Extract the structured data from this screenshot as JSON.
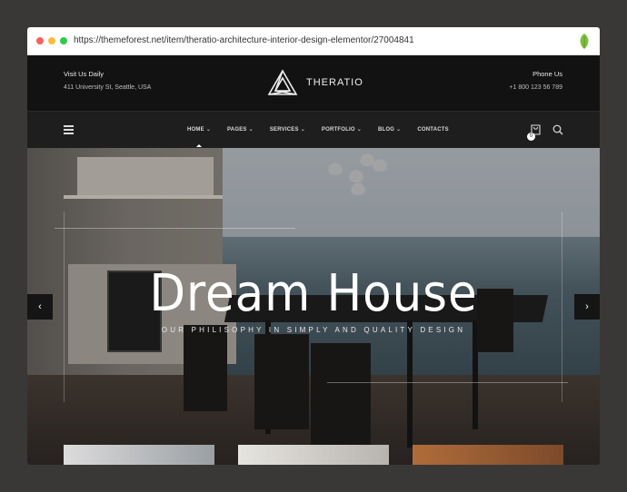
{
  "browser": {
    "url": "https://themeforest.net/item/theratio-architecture-interior-design-elementor/27004841",
    "dot_colors": [
      "#fc605c",
      "#fdbc40",
      "#34c84a"
    ]
  },
  "topbar": {
    "visit_label": "Visit Us Daily",
    "address": "411 University St, Seattle, USA",
    "phone_label": "Phone Us",
    "phone": "+1 800 123 56 789"
  },
  "brand": {
    "name": "THERATIO",
    "logo_icon": "triangle-logo-icon"
  },
  "nav": {
    "items": [
      {
        "label": "HOME",
        "dropdown": true,
        "active": true
      },
      {
        "label": "PAGES",
        "dropdown": true
      },
      {
        "label": "SERVICES",
        "dropdown": true
      },
      {
        "label": "PORTFOLIO",
        "dropdown": true
      },
      {
        "label": "BLOG",
        "dropdown": true
      },
      {
        "label": "CONTACTS",
        "dropdown": false
      }
    ],
    "cart_count": "0"
  },
  "hero": {
    "title": "Dream House",
    "subtitle": "OUR PHILISOPHY IN SIMPLY AND QUALITY DESIGN",
    "prev": "‹",
    "next": "›"
  },
  "colors": {
    "topbar_bg": "#121212",
    "nav_bg": "#1e1e1e",
    "accent": "#ffffff"
  }
}
